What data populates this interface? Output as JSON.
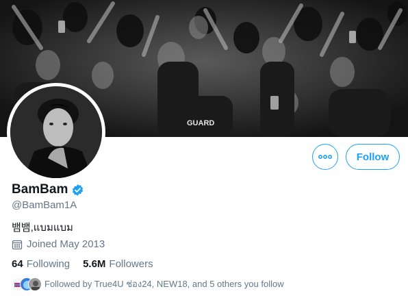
{
  "profile": {
    "display_name": "BamBam",
    "handle": "@BamBam1A",
    "bio": "뱀뱀,แบมแบม",
    "joined": "Joined May 2013",
    "verified": true
  },
  "actions": {
    "more_icon": "ellipsis-icon",
    "follow_label": "Follow"
  },
  "stats": {
    "following_count": "64",
    "following_label": "Following",
    "followers_count": "5.6M",
    "followers_label": "Followers"
  },
  "followed_by": {
    "text": "Followed by True4U ช่อง24, NEW18, and 5 others you follow"
  },
  "banner": {
    "guard_text": "GUARD"
  },
  "colors": {
    "accent": "#1da1f2",
    "secondary_text": "#657786",
    "primary_text": "#14171a"
  }
}
